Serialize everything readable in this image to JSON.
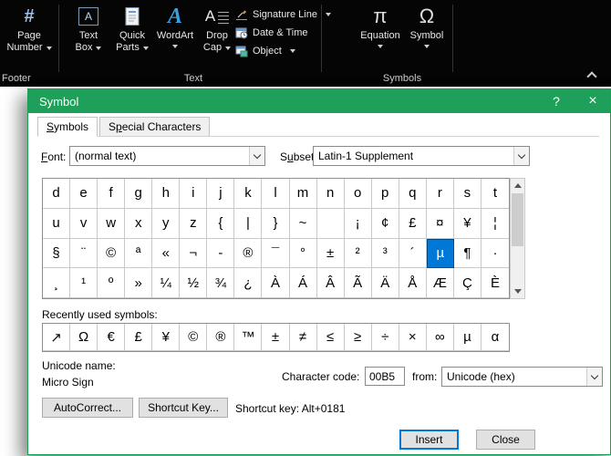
{
  "colors": {
    "title_green": "#1fa05a",
    "selection_blue": "#0078d7",
    "ribbon_black": "#050505"
  },
  "icons": {
    "page_number_hash": "#",
    "text_box_letter": "A",
    "wordart_letter": "A",
    "drop_cap_letter": "A",
    "equation_pi": "π",
    "symbol_omega": "Ω"
  },
  "ribbon": {
    "page_number": {
      "line1": "Page",
      "line2": "Number"
    },
    "text_box": {
      "line1": "Text",
      "line2": "Box"
    },
    "quick_parts": {
      "line1": "Quick",
      "line2": "Parts"
    },
    "wordart": {
      "label": "WordArt"
    },
    "drop_cap": {
      "line1": "Drop",
      "line2": "Cap"
    },
    "signature_line": "Signature Line",
    "date_time": "Date & Time",
    "object_label": "Object",
    "equation": "Equation",
    "symbol": "Symbol",
    "group_footer": "Footer",
    "group_text": "Text",
    "group_symbols": "Symbols"
  },
  "dialog": {
    "title": "Symbol",
    "titlebar_help": "?",
    "titlebar_close": "×",
    "tabs": [
      {
        "label": "Symbols"
      },
      {
        "label": "Special Characters"
      }
    ],
    "font_label": "Font:",
    "font_value": "(normal text)",
    "subset_label": "Subset:",
    "subset_value": "Latin-1 Supplement",
    "grid": {
      "rows": [
        [
          "d",
          "e",
          "f",
          "g",
          "h",
          "i",
          "j",
          "k",
          "l",
          "m",
          "n",
          "o",
          "p",
          "q",
          "r",
          "s",
          "t"
        ],
        [
          "u",
          "v",
          "w",
          "x",
          "y",
          "z",
          "{",
          "|",
          "}",
          "~",
          "",
          "¡",
          "¢",
          "£",
          "¤",
          "¥",
          "¦"
        ],
        [
          "§",
          "¨",
          "©",
          "ª",
          "«",
          "¬",
          "-",
          "®",
          "¯",
          "°",
          "±",
          "²",
          "³",
          "´",
          "µ",
          "¶",
          "·"
        ],
        [
          "¸",
          "¹",
          "º",
          "»",
          "¼",
          "½",
          "¾",
          "¿",
          "À",
          "Á",
          "Â",
          "Ã",
          "Ä",
          "Å",
          "Æ",
          "Ç",
          "È"
        ]
      ],
      "selected": {
        "row": 2,
        "col": 14,
        "char": "µ"
      }
    },
    "recent_label": "Recently used symbols:",
    "recent": [
      "↗",
      "Ω",
      "€",
      "£",
      "¥",
      "©",
      "®",
      "™",
      "±",
      "≠",
      "≤",
      "≥",
      "÷",
      "×",
      "∞",
      "µ",
      "α"
    ],
    "unicode_name_label": "Unicode name:",
    "unicode_name": "Micro Sign",
    "char_code_label": "Character code:",
    "char_code_value": "00B5",
    "from_label": "from:",
    "from_value": "Unicode (hex)",
    "autocorrect_label": "AutoCorrect...",
    "shortcut_key_label": "Shortcut Key...",
    "shortcut_text": "Shortcut key: Alt+0181",
    "insert_label": "Insert",
    "close_label": "Close"
  }
}
